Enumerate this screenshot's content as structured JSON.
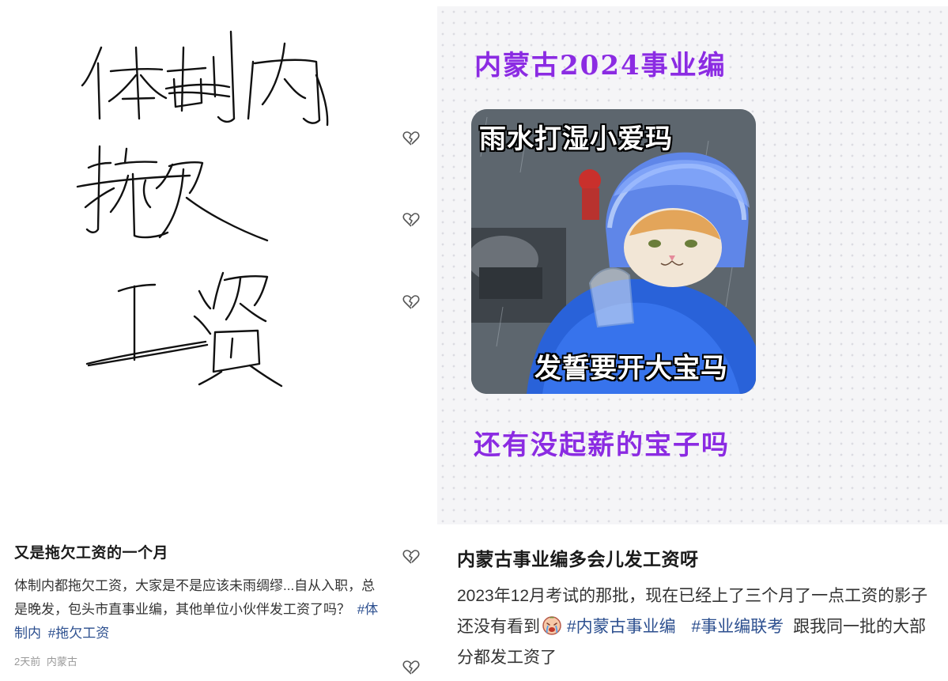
{
  "left_post": {
    "image": {
      "handwritten_text": [
        "体制内",
        "拖欠",
        "工资"
      ]
    },
    "title": "又是拖欠工资的一个月",
    "body": "体制内都拖欠工资，大家是不是应该未雨绸缪...自从入职，总是晚发，包头市直事业编，其他单位小伙伴发工资了吗？",
    "tags": [
      "#体制内",
      "#拖欠工资"
    ],
    "time": "2天前",
    "location": "内蒙古"
  },
  "right_post": {
    "image": {
      "poster_title": "内蒙古2024事业编",
      "meme_top_caption": "雨水打湿小爱玛",
      "meme_bottom_caption": "发誓要开大宝马",
      "poster_bottom": "还有没起薪的宝子吗"
    },
    "title": "内蒙古事业编多会儿发工资呀",
    "body_part1": "2023年12月考试的那批，现在已经上了三个月了一点工资的影子还没有看到",
    "emoji_icon": "crying-face-emoji",
    "tags": [
      "#内蒙古事业编",
      "#事业编联考"
    ],
    "body_part2": "跟我同一批的大部分都发工资了"
  },
  "heart_icons": [
    "broken-heart-icon",
    "broken-heart-icon",
    "broken-heart-icon",
    "broken-heart-icon",
    "broken-heart-icon"
  ],
  "colors": {
    "poster_purple": "#8b2be2",
    "tag_blue": "#2c4f8f",
    "meta_gray": "#999999"
  }
}
